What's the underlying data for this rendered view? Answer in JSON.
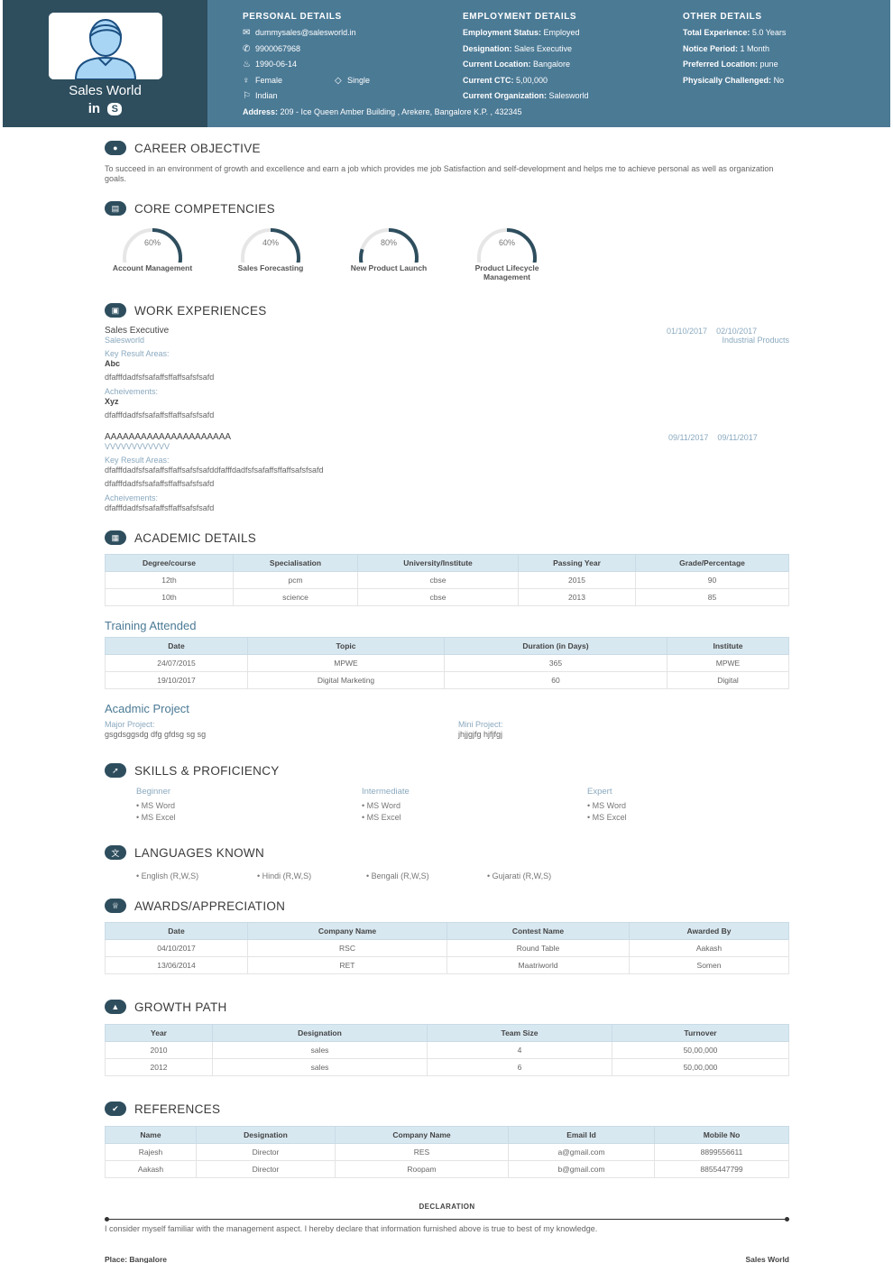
{
  "profile": {
    "name": "Sales World",
    "social": [
      "in",
      "S"
    ]
  },
  "personal": {
    "title": "PERSONAL DETAILS",
    "email": "dummysales@salesworld.in",
    "phone": "9900067968",
    "dob": "1990-06-14",
    "gender": "Female",
    "marital": "Single",
    "nationality": "Indian",
    "address_label": "Address:",
    "address": "209 - Ice Queen Amber Building , Arekere, Bangalore K.P. , 432345"
  },
  "employment": {
    "title": "EMPLOYMENT DETAILS",
    "rows": [
      {
        "label": "Employment Status:",
        "value": "Employed"
      },
      {
        "label": "Designation:",
        "value": "Sales Executive"
      },
      {
        "label": "Current Location:",
        "value": "Bangalore"
      },
      {
        "label": "Current CTC:",
        "value": "5,00,000"
      },
      {
        "label": "Current Organization:",
        "value": "Salesworld"
      }
    ]
  },
  "other": {
    "title": "OTHER DETAILS",
    "rows": [
      {
        "label": "Total Experience:",
        "value": "5.0 Years"
      },
      {
        "label": "Notice Period:",
        "value": "1 Month"
      },
      {
        "label": "Preferred Location:",
        "value": "pune"
      },
      {
        "label": "Physically Challenged:",
        "value": "No"
      }
    ]
  },
  "career": {
    "title": "CAREER OBJECTIVE",
    "text": "To succeed in an environment of growth and excellence and earn a job which provides me job Satisfaction and self-development and helps me to achieve personal as well as organization goals."
  },
  "competencies": {
    "title": "CORE COMPETENCIES",
    "items": [
      {
        "label": "Account Management",
        "percent": 60,
        "text": "60%"
      },
      {
        "label": "Sales Forecasting",
        "percent": 40,
        "text": "40%"
      },
      {
        "label": "New Product Launch",
        "percent": 80,
        "text": "80%"
      },
      {
        "label": "Product Lifecycle Management",
        "percent": 60,
        "text": "60%"
      }
    ]
  },
  "work": {
    "title": "WORK EXPERIENCES",
    "jobs": [
      {
        "role": "Sales Executive",
        "company": "Salesworld",
        "from": "01/10/2017",
        "to": "02/10/2017",
        "industry": "Industrial Products",
        "kra_label": "Key Result Areas:",
        "kra_bold": "Abc",
        "kra_text": "dfafffdadfsfsafaffsffaffsafsfsafd",
        "ach_label": "Acheivements:",
        "ach_bold": "Xyz",
        "ach_text": "dfafffdadfsfsafaffsffaffsafsfsafd"
      },
      {
        "role": "AAAAAAAAAAAAAAAAAAAAA",
        "company": "VVVVVVVVVVVV",
        "from": "09/11/2017",
        "to": "09/11/2017",
        "kra_label": "Key Result Areas:",
        "kra_text": "dfafffdadfsfsafaffsffaffsafsfsafddfafffdadfsfsafaffsffaffsafsfsafd",
        "kra_text2": "dfafffdadfsfsafaffsffaffsafsfsafd",
        "ach_label": "Acheivements:",
        "ach_text": "dfafffdadfsfsafaffsffaffsafsfsafd"
      }
    ]
  },
  "academic": {
    "title": "ACADEMIC DETAILS",
    "headers": [
      "Degree/course",
      "Specialisation",
      "University/Institute",
      "Passing Year",
      "Grade/Percentage"
    ],
    "rows": [
      [
        "12th",
        "pcm",
        "cbse",
        "2015",
        "90"
      ],
      [
        "10th",
        "science",
        "cbse",
        "2013",
        "85"
      ]
    ]
  },
  "training": {
    "title": "Training Attended",
    "headers": [
      "Date",
      "Topic",
      "Duration (in Days)",
      "Institute"
    ],
    "rows": [
      [
        "24/07/2015",
        "MPWE",
        "365",
        "MPWE"
      ],
      [
        "19/10/2017",
        "Digital Marketing",
        "60",
        "Digital"
      ]
    ]
  },
  "project": {
    "title": "Acadmic Project",
    "major_label": "Major Project:",
    "major": "gsgdsggsdg dfg gfdsg sg sg",
    "mini_label": "Mini Project:",
    "mini": "jhjjgjfg hjfjfgj"
  },
  "skills": {
    "title": "SKILLS & PROFICIENCY",
    "levels": [
      {
        "name": "Beginner",
        "items": [
          "MS Word",
          "MS Excel"
        ]
      },
      {
        "name": "Intermediate",
        "items": [
          "MS Word",
          "MS Excel"
        ]
      },
      {
        "name": "Expert",
        "items": [
          "MS Word",
          "MS Excel"
        ]
      }
    ]
  },
  "languages": {
    "title": "LANGUAGES KNOWN",
    "items": [
      "English (R,W,S)",
      "Hindi (R,W,S)",
      "Bengali (R,W,S)",
      "Gujarati (R,W,S)"
    ]
  },
  "awards": {
    "title": "AWARDS/APPRECIATION",
    "headers": [
      "Date",
      "Company Name",
      "Contest Name",
      "Awarded By"
    ],
    "rows": [
      [
        "04/10/2017",
        "RSC",
        "Round Table",
        "Aakash"
      ],
      [
        "13/06/2014",
        "RET",
        "Maatriworld",
        "Somen"
      ]
    ]
  },
  "growth": {
    "title": "GROWTH PATH",
    "headers": [
      "Year",
      "Designation",
      "Team Size",
      "Turnover"
    ],
    "rows": [
      [
        "2010",
        "sales",
        "4",
        "50,00,000"
      ],
      [
        "2012",
        "sales",
        "6",
        "50,00,000"
      ]
    ]
  },
  "references": {
    "title": "REFERENCES",
    "headers": [
      "Name",
      "Designation",
      "Company Name",
      "Email Id",
      "Mobile No"
    ],
    "rows": [
      [
        "Rajesh",
        "Director",
        "RES",
        "a@gmail.com",
        "8899556611"
      ],
      [
        "Aakash",
        "Director",
        "Roopam",
        "b@gmail.com",
        "8855447799"
      ]
    ]
  },
  "declaration": {
    "title": "DECLARATION",
    "text": "I consider myself familiar with the management aspect. I hereby declare that information furnished above is true to best of my knowledge.",
    "place_label": "Place:",
    "place": "Bangalore",
    "signature": "Sales World"
  },
  "colors": {
    "header": "#4b7a95",
    "profile": "#2e4e5e",
    "table_head": "#d8e8f1"
  }
}
